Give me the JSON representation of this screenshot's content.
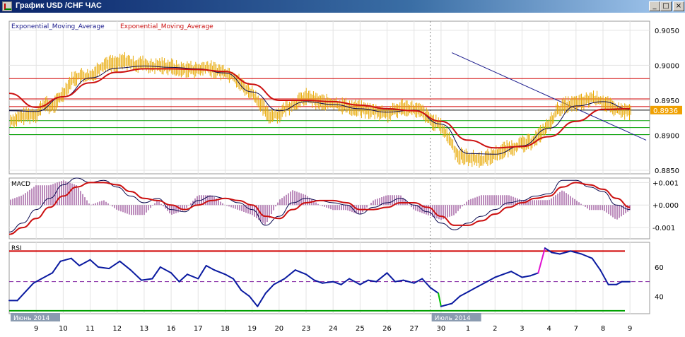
{
  "window": {
    "title": "График USD /CHF ЧАС",
    "minimize_glyph": "_",
    "maximize_glyph": "□",
    "close_glyph": "×"
  },
  "chart_data": [
    {
      "type": "line",
      "panel": "price",
      "legend": [
        "Exponential_Moving_Average",
        "Exponential_Moving_Average"
      ],
      "y_ticks": [
        0.905,
        0.9,
        0.895,
        0.89,
        0.885
      ],
      "y_tick_labels": [
        "0.9050",
        "0.9000",
        "0.8950",
        "0.8900",
        "0.8850"
      ],
      "ylim": [
        0.8845,
        0.9063
      ],
      "last_price": 0.8936,
      "last_price_label": "0.8936",
      "x_labels": [
        "9",
        "10",
        "11",
        "12",
        "13",
        "16",
        "17",
        "18",
        "19",
        "20",
        "23",
        "24",
        "25",
        "26",
        "27",
        "30",
        "1",
        "2",
        "3",
        "4",
        "7",
        "8",
        "9"
      ],
      "date_labels": [
        "Июнь 2014",
        "Июль 2014"
      ],
      "horizontal_levels": [
        {
          "value": 0.8981,
          "color": "#d00000"
        },
        {
          "value": 0.8952,
          "color": "#d00000"
        },
        {
          "value": 0.8941,
          "color": "#d00000"
        },
        {
          "value": 0.8936,
          "color": "#000000"
        },
        {
          "value": 0.8921,
          "color": "#00a000"
        },
        {
          "value": 0.8911,
          "color": "#00a000"
        },
        {
          "value": 0.8901,
          "color": "#00a000"
        }
      ],
      "trendline": {
        "from": {
          "x": 16.4,
          "y": 0.9018
        },
        "to": {
          "x": 23.6,
          "y": 0.8893
        },
        "color": "#1a1a8c"
      },
      "price": [
        [
          0,
          0.892
        ],
        [
          0.6,
          0.8928
        ],
        [
          1.0,
          0.893
        ],
        [
          1.3,
          0.8945
        ],
        [
          1.6,
          0.894
        ],
        [
          2.0,
          0.896
        ],
        [
          2.3,
          0.8978
        ],
        [
          2.6,
          0.8985
        ],
        [
          3.0,
          0.8983
        ],
        [
          3.3,
          0.8995
        ],
        [
          3.6,
          0.9003
        ],
        [
          4.0,
          0.9002
        ],
        [
          4.3,
          0.9007
        ],
        [
          4.6,
          0.9001
        ],
        [
          5.0,
          0.9002
        ],
        [
          5.3,
          0.8997
        ],
        [
          5.6,
          0.9
        ],
        [
          6.0,
          0.8998
        ],
        [
          6.3,
          0.8993
        ],
        [
          6.6,
          0.8995
        ],
        [
          7.0,
          0.8993
        ],
        [
          7.3,
          0.8997
        ],
        [
          7.6,
          0.8993
        ],
        [
          8.0,
          0.899
        ],
        [
          8.3,
          0.8985
        ],
        [
          8.6,
          0.8972
        ],
        [
          9.0,
          0.896
        ],
        [
          9.3,
          0.8945
        ],
        [
          9.6,
          0.8928
        ],
        [
          10.0,
          0.893
        ],
        [
          10.3,
          0.894
        ],
        [
          10.6,
          0.8945
        ],
        [
          11.0,
          0.8955
        ],
        [
          11.3,
          0.895
        ],
        [
          11.6,
          0.8947
        ],
        [
          12.0,
          0.8945
        ],
        [
          12.3,
          0.8943
        ],
        [
          12.6,
          0.894
        ],
        [
          13.0,
          0.8938
        ],
        [
          13.3,
          0.8935
        ],
        [
          13.6,
          0.8934
        ],
        [
          14.0,
          0.893
        ],
        [
          14.3,
          0.8935
        ],
        [
          14.6,
          0.8941
        ],
        [
          15.0,
          0.8937
        ],
        [
          15.3,
          0.8933
        ],
        [
          15.6,
          0.8922
        ],
        [
          16.0,
          0.8912
        ],
        [
          16.3,
          0.8895
        ],
        [
          16.6,
          0.8872
        ],
        [
          17.0,
          0.8868
        ],
        [
          17.3,
          0.8866
        ],
        [
          17.6,
          0.8866
        ],
        [
          18.0,
          0.8873
        ],
        [
          18.3,
          0.8879
        ],
        [
          18.6,
          0.8882
        ],
        [
          19.0,
          0.8887
        ],
        [
          19.3,
          0.889
        ],
        [
          19.6,
          0.8899
        ],
        [
          20.0,
          0.8915
        ],
        [
          20.3,
          0.8935
        ],
        [
          20.6,
          0.8943
        ],
        [
          21.0,
          0.8945
        ],
        [
          21.3,
          0.8948
        ],
        [
          21.6,
          0.8953
        ],
        [
          22.0,
          0.8948
        ],
        [
          22.3,
          0.894
        ],
        [
          22.6,
          0.8935
        ],
        [
          23.0,
          0.8934
        ]
      ],
      "ema_fast": [
        [
          0,
          0.8935
        ],
        [
          1,
          0.8934
        ],
        [
          2,
          0.8955
        ],
        [
          3,
          0.8982
        ],
        [
          4,
          0.8996
        ],
        [
          5,
          0.8999
        ],
        [
          6,
          0.8997
        ],
        [
          7,
          0.8995
        ],
        [
          8,
          0.8989
        ],
        [
          9,
          0.8962
        ],
        [
          10,
          0.8935
        ],
        [
          11,
          0.8948
        ],
        [
          12,
          0.8944
        ],
        [
          13,
          0.8938
        ],
        [
          14,
          0.8933
        ],
        [
          15,
          0.8936
        ],
        [
          16,
          0.8916
        ],
        [
          17,
          0.8874
        ],
        [
          18,
          0.8873
        ],
        [
          19,
          0.8885
        ],
        [
          20,
          0.891
        ],
        [
          21,
          0.8942
        ],
        [
          22,
          0.8948
        ],
        [
          23,
          0.8937
        ]
      ],
      "ema_slow": [
        [
          0,
          0.896
        ],
        [
          1,
          0.894
        ],
        [
          2,
          0.8955
        ],
        [
          3,
          0.8975
        ],
        [
          4,
          0.899
        ],
        [
          5,
          0.8995
        ],
        [
          6,
          0.8995
        ],
        [
          7,
          0.8994
        ],
        [
          8,
          0.8991
        ],
        [
          9,
          0.8973
        ],
        [
          10,
          0.895
        ],
        [
          11,
          0.895
        ],
        [
          12,
          0.8948
        ],
        [
          13,
          0.8943
        ],
        [
          14,
          0.8938
        ],
        [
          15,
          0.8935
        ],
        [
          16,
          0.892
        ],
        [
          17,
          0.8893
        ],
        [
          18,
          0.8882
        ],
        [
          19,
          0.8884
        ],
        [
          20,
          0.8898
        ],
        [
          21,
          0.892
        ],
        [
          22,
          0.8937
        ],
        [
          23,
          0.8938
        ]
      ]
    },
    {
      "type": "line",
      "panel": "macd",
      "label": "MACD",
      "y_ticks": [
        0.001,
        0,
        -0.001
      ],
      "y_tick_labels": [
        "+0.001",
        "+0.000",
        "-0.001"
      ],
      "ylim": [
        -0.0015,
        0.0012
      ],
      "macd": [
        [
          0,
          -0.0012
        ],
        [
          0.5,
          -0.0008
        ],
        [
          1,
          -0.0002
        ],
        [
          1.5,
          0.0003
        ],
        [
          2,
          0.0009
        ],
        [
          2.5,
          0.0012
        ],
        [
          3,
          0.001
        ],
        [
          3.5,
          0.0011
        ],
        [
          4,
          0.0008
        ],
        [
          4.5,
          0.0004
        ],
        [
          5,
          0.0001
        ],
        [
          5.5,
          0.0003
        ],
        [
          6,
          -0.0002
        ],
        [
          6.5,
          -0.0003
        ],
        [
          7,
          0.0002
        ],
        [
          7.5,
          0.0004
        ],
        [
          8,
          0.0003
        ],
        [
          8.5,
          0.0001
        ],
        [
          9,
          -0.0002
        ],
        [
          9.5,
          -0.0009
        ],
        [
          10,
          -0.0005
        ],
        [
          10.5,
          0.0001
        ],
        [
          11,
          0.0003
        ],
        [
          11.5,
          0.0002
        ],
        [
          12,
          0.0001
        ],
        [
          12.5,
          0.0
        ],
        [
          13,
          -0.0004
        ],
        [
          13.5,
          -0.0001
        ],
        [
          14,
          0.0001
        ],
        [
          14.5,
          0.0003
        ],
        [
          15,
          0.0
        ],
        [
          15.5,
          -0.0003
        ],
        [
          16,
          -0.0008
        ],
        [
          16.5,
          -0.0011
        ],
        [
          17,
          -0.0008
        ],
        [
          17.5,
          -0.0005
        ],
        [
          18,
          -0.0002
        ],
        [
          18.5,
          0.0001
        ],
        [
          19,
          0.0002
        ],
        [
          19.5,
          0.0004
        ],
        [
          20,
          0.0005
        ],
        [
          20.5,
          0.0011
        ],
        [
          21,
          0.0011
        ],
        [
          21.5,
          0.0008
        ],
        [
          22,
          0.0006
        ],
        [
          22.5,
          0.0
        ],
        [
          23,
          -0.0002
        ]
      ],
      "signal": [
        [
          0,
          -0.0013
        ],
        [
          0.5,
          -0.001
        ],
        [
          1,
          -0.0006
        ],
        [
          1.5,
          -0.0001
        ],
        [
          2,
          0.0004
        ],
        [
          2.5,
          0.0008
        ],
        [
          3,
          0.001
        ],
        [
          3.5,
          0.001
        ],
        [
          4,
          0.0009
        ],
        [
          4.5,
          0.0006
        ],
        [
          5,
          0.0003
        ],
        [
          5.5,
          0.0002
        ],
        [
          6,
          0.0
        ],
        [
          6.5,
          -0.0002
        ],
        [
          7,
          0.0
        ],
        [
          7.5,
          0.0002
        ],
        [
          8,
          0.0003
        ],
        [
          8.5,
          0.0002
        ],
        [
          9,
          0.0
        ],
        [
          9.5,
          -0.0005
        ],
        [
          10,
          -0.0006
        ],
        [
          10.5,
          -0.0002
        ],
        [
          11,
          0.0001
        ],
        [
          11.5,
          0.0002
        ],
        [
          12,
          0.0002
        ],
        [
          12.5,
          0.0001
        ],
        [
          13,
          -0.0002
        ],
        [
          13.5,
          -0.0002
        ],
        [
          14,
          -0.0001
        ],
        [
          14.5,
          0.0001
        ],
        [
          15,
          0.0001
        ],
        [
          15.5,
          -0.0001
        ],
        [
          16,
          -0.0005
        ],
        [
          16.5,
          -0.0009
        ],
        [
          17,
          -0.0009
        ],
        [
          17.5,
          -0.0007
        ],
        [
          18,
          -0.0004
        ],
        [
          18.5,
          -0.0001
        ],
        [
          19,
          0.0001
        ],
        [
          19.5,
          0.0003
        ],
        [
          20,
          0.0004
        ],
        [
          20.5,
          0.0008
        ],
        [
          21,
          0.001
        ],
        [
          21.5,
          0.0009
        ],
        [
          22,
          0.0007
        ],
        [
          22.5,
          0.0003
        ],
        [
          23,
          -0.0001
        ]
      ]
    },
    {
      "type": "line",
      "panel": "rsi",
      "label": "RSI",
      "y_ticks": [
        60,
        40
      ],
      "y_tick_labels": [
        "60",
        "40"
      ],
      "ylim": [
        28,
        77
      ],
      "levels": [
        {
          "value": 71,
          "color": "#d00000"
        },
        {
          "value": 50,
          "color": "#8020a0",
          "dashed": true
        },
        {
          "value": 30,
          "color": "#00a000"
        }
      ],
      "rsi": [
        [
          0,
          37
        ],
        [
          0.3,
          37
        ],
        [
          0.6,
          43
        ],
        [
          0.9,
          49
        ],
        [
          1.2,
          52
        ],
        [
          1.6,
          56
        ],
        [
          1.9,
          64
        ],
        [
          2.3,
          66
        ],
        [
          2.6,
          61
        ],
        [
          3.0,
          65
        ],
        [
          3.3,
          60
        ],
        [
          3.7,
          59
        ],
        [
          4.1,
          64
        ],
        [
          4.5,
          58
        ],
        [
          4.9,
          51
        ],
        [
          5.3,
          52
        ],
        [
          5.6,
          60
        ],
        [
          6.0,
          56
        ],
        [
          6.3,
          50
        ],
        [
          6.6,
          55
        ],
        [
          7.0,
          52
        ],
        [
          7.3,
          61
        ],
        [
          7.6,
          58
        ],
        [
          8.0,
          55
        ],
        [
          8.3,
          52
        ],
        [
          8.6,
          44
        ],
        [
          8.9,
          40
        ],
        [
          9.2,
          33
        ],
        [
          9.5,
          42
        ],
        [
          9.8,
          48
        ],
        [
          10.2,
          52
        ],
        [
          10.6,
          58
        ],
        [
          11.0,
          55
        ],
        [
          11.3,
          51
        ],
        [
          11.6,
          49
        ],
        [
          12.0,
          50
        ],
        [
          12.3,
          48
        ],
        [
          12.6,
          52
        ],
        [
          13.0,
          48
        ],
        [
          13.3,
          51
        ],
        [
          13.6,
          50
        ],
        [
          14.0,
          56
        ],
        [
          14.3,
          50
        ],
        [
          14.6,
          51
        ],
        [
          15.0,
          49
        ],
        [
          15.3,
          52
        ],
        [
          15.6,
          46
        ],
        [
          15.9,
          42
        ],
        [
          16.0,
          33
        ],
        [
          16.2,
          34
        ],
        [
          16.4,
          35
        ],
        [
          16.7,
          40
        ],
        [
          17.0,
          43
        ],
        [
          17.3,
          46
        ],
        [
          17.7,
          50
        ],
        [
          18.0,
          53
        ],
        [
          18.3,
          55
        ],
        [
          18.6,
          57
        ],
        [
          19.0,
          53
        ],
        [
          19.3,
          54
        ],
        [
          19.6,
          56
        ],
        [
          19.85,
          73
        ],
        [
          20.1,
          70
        ],
        [
          20.4,
          69
        ],
        [
          20.8,
          71
        ],
        [
          21.2,
          69
        ],
        [
          21.6,
          66
        ],
        [
          21.9,
          58
        ],
        [
          22.2,
          48
        ],
        [
          22.5,
          48
        ],
        [
          22.7,
          50
        ],
        [
          23.0,
          50
        ]
      ]
    }
  ]
}
